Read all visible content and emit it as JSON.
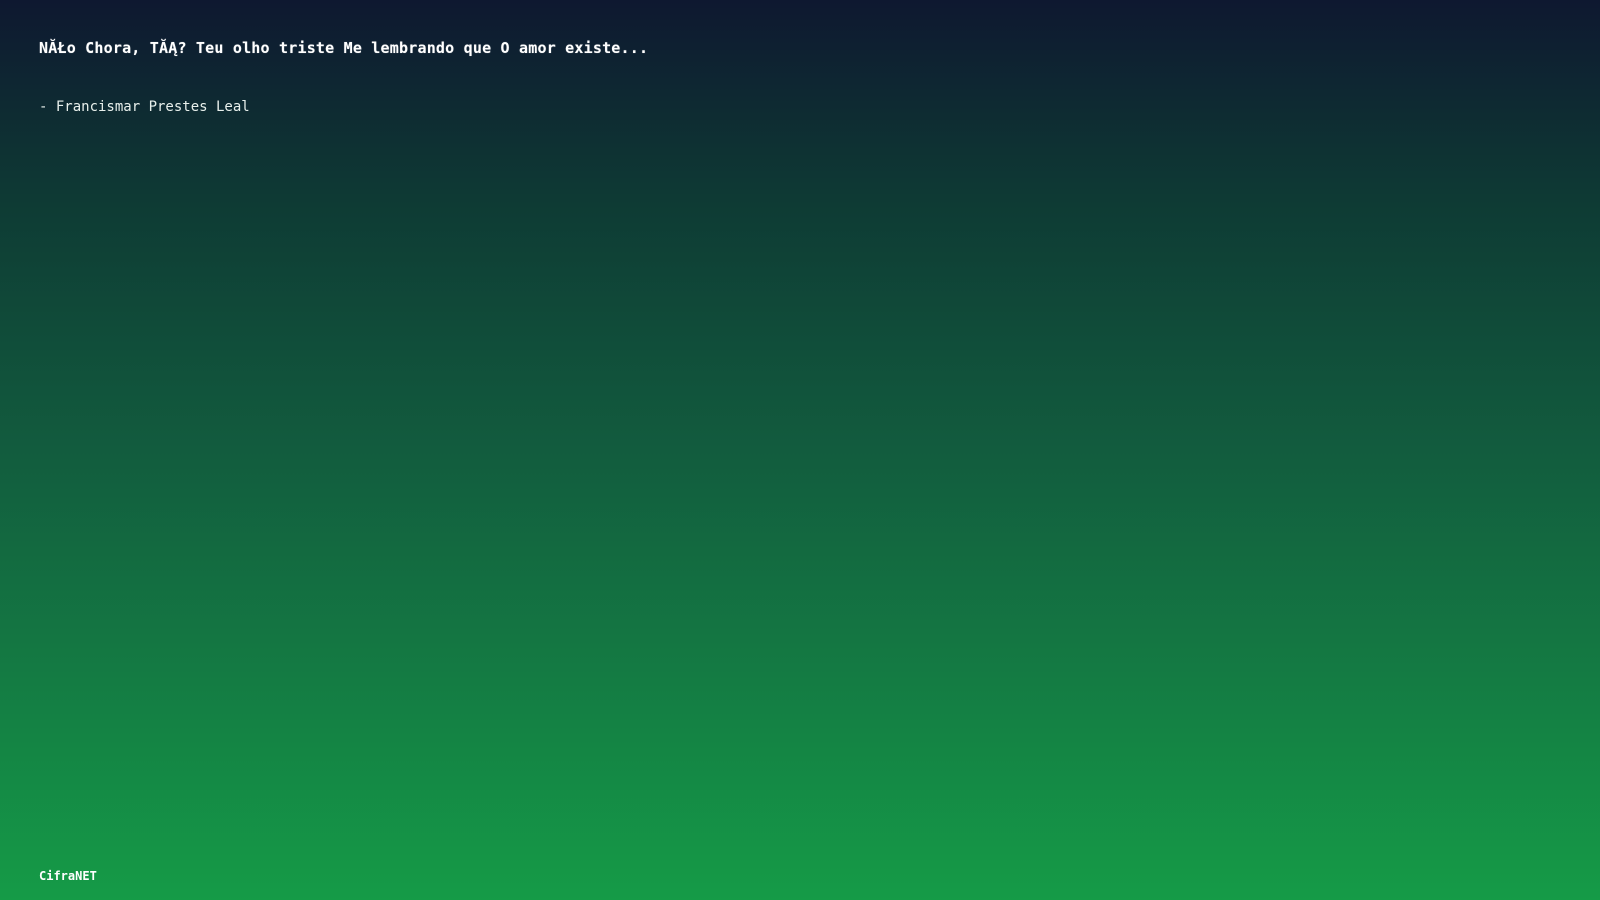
{
  "quote": {
    "text": "NĂŁo Chora, TĂĄ? Teu olho triste Me lembrando que O amor existe...",
    "author": "- Francismar Prestes Leal"
  },
  "footer": {
    "brand": "CifraNET"
  },
  "colors": {
    "gradient_top": "#0e1830",
    "gradient_bottom": "#159b47",
    "text": "#ffffff"
  }
}
